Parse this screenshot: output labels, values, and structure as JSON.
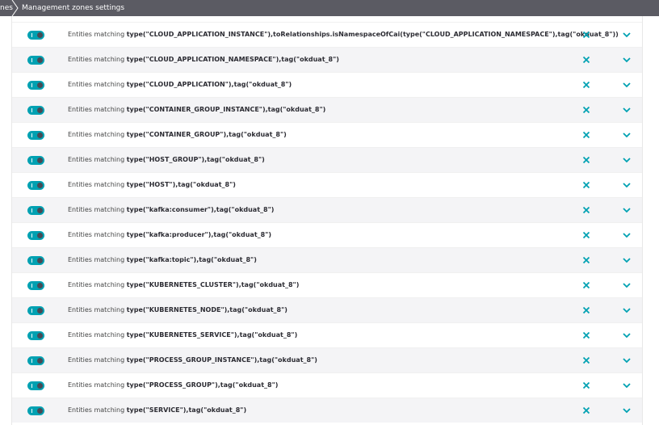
{
  "breadcrumb": {
    "previous": "nes",
    "current": "Management zones settings"
  },
  "colors": {
    "accent": "#00a1b2",
    "topbar": "#5b5b63",
    "row_alt": "#f4f4f6"
  },
  "rules": [
    {
      "prefix": "Entities matching",
      "expression": "type(\"CLOUD_APPLICATION_INSTANCE\"),toRelationships.isNamespaceOfCai(type(\"CLOUD_APPLICATION_NAMESPACE\"),tag(\"okduat_8\"))",
      "enabled": true
    },
    {
      "prefix": "Entities matching",
      "expression": "type(\"CLOUD_APPLICATION_NAMESPACE\"),tag(\"okduat_8\")",
      "enabled": true
    },
    {
      "prefix": "Entities matching",
      "expression": "type(\"CLOUD_APPLICATION\"),tag(\"okduat_8\")",
      "enabled": true
    },
    {
      "prefix": "Entities matching",
      "expression": "type(\"CONTAINER_GROUP_INSTANCE\"),tag(\"okduat_8\")",
      "enabled": true
    },
    {
      "prefix": "Entities matching",
      "expression": "type(\"CONTAINER_GROUP\"),tag(\"okduat_8\")",
      "enabled": true
    },
    {
      "prefix": "Entities matching",
      "expression": "type(\"HOST_GROUP\"),tag(\"okduat_8\")",
      "enabled": true
    },
    {
      "prefix": "Entities matching",
      "expression": "type(\"HOST\"),tag(\"okduat_8\")",
      "enabled": true
    },
    {
      "prefix": "Entities matching",
      "expression": "type(\"kafka:consumer\"),tag(\"okduat_8\")",
      "enabled": true
    },
    {
      "prefix": "Entities matching",
      "expression": "type(\"kafka:producer\"),tag(\"okduat_8\")",
      "enabled": true
    },
    {
      "prefix": "Entities matching",
      "expression": "type(\"kafka:topic\"),tag(\"okduat_8\")",
      "enabled": true
    },
    {
      "prefix": "Entities matching",
      "expression": "type(\"KUBERNETES_CLUSTER\"),tag(\"okduat_8\")",
      "enabled": true
    },
    {
      "prefix": "Entities matching",
      "expression": "type(\"KUBERNETES_NODE\"),tag(\"okduat_8\")",
      "enabled": true
    },
    {
      "prefix": "Entities matching",
      "expression": "type(\"KUBERNETES_SERVICE\"),tag(\"okduat_8\")",
      "enabled": true
    },
    {
      "prefix": "Entities matching",
      "expression": "type(\"PROCESS_GROUP_INSTANCE\"),tag(\"okduat_8\")",
      "enabled": true
    },
    {
      "prefix": "Entities matching",
      "expression": "type(\"PROCESS_GROUP\"),tag(\"okduat_8\")",
      "enabled": true
    },
    {
      "prefix": "Entities matching",
      "expression": "type(\"SERVICE\"),tag(\"okduat_8\")",
      "enabled": true
    }
  ]
}
